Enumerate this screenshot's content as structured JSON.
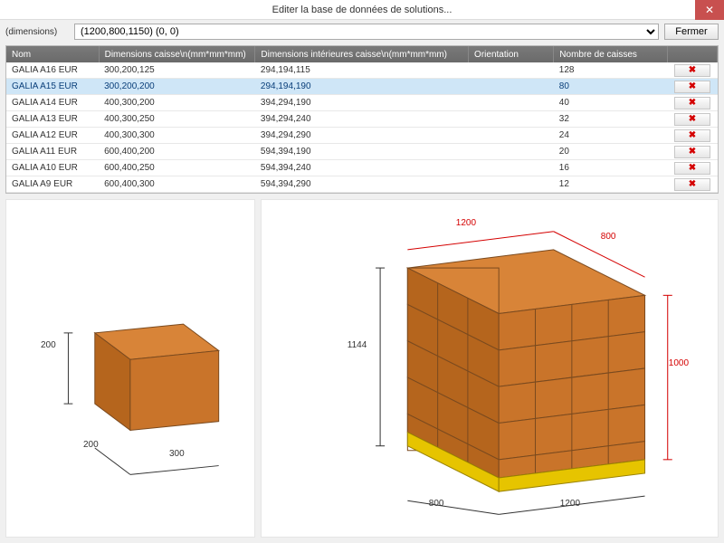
{
  "window": {
    "title": "Editer la base de données de solutions..."
  },
  "controls": {
    "dimensions_label": "(dimensions)",
    "dropdown_value": "(1200,800,1150) (0, 0)",
    "close_button": "Fermer"
  },
  "table": {
    "headers": {
      "nom": "Nom",
      "dims": "Dimensions caisse\\n(mm*mm*mm)",
      "inner": "Dimensions intérieures caisse\\n(mm*mm*mm)",
      "orient": "Orientation",
      "count": "Nombre de caisses"
    },
    "rows": [
      {
        "nom": "GALIA A16 EUR",
        "dims": "300,200,125",
        "inner": "294,194,115",
        "orient": "",
        "count": "128",
        "selected": false
      },
      {
        "nom": "GALIA A15 EUR",
        "dims": "300,200,200",
        "inner": "294,194,190",
        "orient": "",
        "count": "80",
        "selected": true
      },
      {
        "nom": "GALIA A14 EUR",
        "dims": "400,300,200",
        "inner": "394,294,190",
        "orient": "",
        "count": "40",
        "selected": false
      },
      {
        "nom": "GALIA A13 EUR",
        "dims": "400,300,250",
        "inner": "394,294,240",
        "orient": "",
        "count": "32",
        "selected": false
      },
      {
        "nom": "GALIA A12 EUR",
        "dims": "400,300,300",
        "inner": "394,294,290",
        "orient": "",
        "count": "24",
        "selected": false
      },
      {
        "nom": "GALIA A11 EUR",
        "dims": "600,400,200",
        "inner": "594,394,190",
        "orient": "",
        "count": "20",
        "selected": false
      },
      {
        "nom": "GALIA A10 EUR",
        "dims": "600,400,250",
        "inner": "594,394,240",
        "orient": "",
        "count": "16",
        "selected": false
      },
      {
        "nom": "GALIA A9 EUR",
        "dims": "600,400,300",
        "inner": "594,394,290",
        "orient": "",
        "count": "12",
        "selected": false
      }
    ]
  },
  "preview_box": {
    "width": "300",
    "depth": "200",
    "height": "200"
  },
  "preview_pallet": {
    "length": "1200",
    "width": "800",
    "top_length": "1200",
    "top_width": "800",
    "stack_height": "1000",
    "total_height": "1144"
  },
  "icons": {
    "close_x": "✕",
    "delete_x": "✖"
  }
}
